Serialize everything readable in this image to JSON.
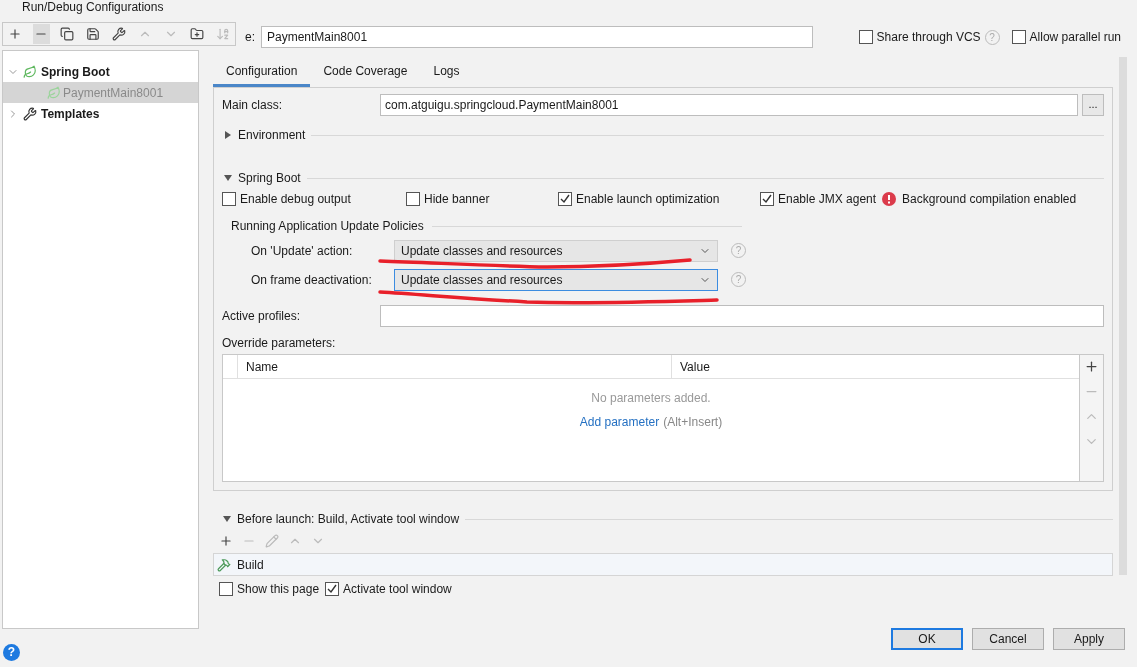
{
  "window": {
    "title": "Run/Debug Configurations"
  },
  "toolbar": [
    {
      "kind": "add",
      "disabled": false,
      "selected": false
    },
    {
      "kind": "remove",
      "disabled": false,
      "selected": true
    },
    {
      "kind": "copy",
      "disabled": false,
      "selected": false
    },
    {
      "kind": "save",
      "disabled": false,
      "selected": false
    },
    {
      "kind": "wrench",
      "disabled": false,
      "selected": false
    },
    {
      "kind": "up",
      "disabled": true,
      "selected": false
    },
    {
      "kind": "down",
      "disabled": true,
      "selected": false
    },
    {
      "kind": "folder",
      "disabled": false,
      "selected": false
    },
    {
      "kind": "sort",
      "disabled": true,
      "selected": false
    }
  ],
  "tree": [
    {
      "label": "Spring Boot",
      "kind": "spring",
      "expanded": true,
      "selected": false,
      "children": [
        {
          "label": "PaymentMain8001",
          "kind": "spring",
          "selected": true
        }
      ]
    },
    {
      "label": "Templates",
      "kind": "wrench",
      "expanded": false,
      "selected": false
    }
  ],
  "help_mark": "?",
  "name": {
    "label": "e:",
    "value": "PaymentMain8001"
  },
  "options": [
    {
      "label": "Share through VCS",
      "checked": false,
      "help": true
    },
    {
      "label": "Allow parallel run",
      "checked": false,
      "help": false
    }
  ],
  "tabs": [
    {
      "label": "Configuration",
      "selected": true
    },
    {
      "label": "Code Coverage",
      "selected": false
    },
    {
      "label": "Logs",
      "selected": false
    }
  ],
  "main_class": {
    "label": "Main class:",
    "value": "com.atguigu.springcloud.PaymentMain8001",
    "browse": "..."
  },
  "environment": {
    "label": "Environment",
    "expanded": false
  },
  "spring_boot": {
    "label": "Spring Boot",
    "expanded": true,
    "checks": [
      {
        "label": "Enable debug output",
        "checked": false
      },
      {
        "label": "Hide banner",
        "checked": false
      },
      {
        "label": "Enable launch optimization",
        "checked": true
      },
      {
        "label": "Enable JMX agent",
        "checked": true
      }
    ],
    "warning": "Background compilation enabled",
    "policies_title": "Running Application Update Policies",
    "policies": [
      {
        "label": "On 'Update' action:",
        "value": "Update classes and resources",
        "focused": false
      },
      {
        "label": "On frame deactivation:",
        "value": "Update classes and resources",
        "focused": true
      }
    ]
  },
  "active_profiles": {
    "label": "Active profiles:"
  },
  "override": {
    "label": "Override parameters:",
    "columns": [
      "Name",
      "Value"
    ],
    "empty": "No parameters added.",
    "link": "Add parameter",
    "shortcut": "(Alt+Insert)",
    "side_buttons": [
      {
        "kind": "add",
        "disabled": false
      },
      {
        "kind": "remove",
        "disabled": true
      },
      {
        "kind": "up",
        "disabled": true
      },
      {
        "kind": "down",
        "disabled": true
      }
    ]
  },
  "before_launch": {
    "label": "Before launch: Build, Activate tool window",
    "expanded": true,
    "tools": [
      {
        "kind": "add",
        "disabled": false
      },
      {
        "kind": "remove",
        "disabled": true
      },
      {
        "kind": "edit",
        "disabled": true
      },
      {
        "kind": "up",
        "disabled": true
      },
      {
        "kind": "down",
        "disabled": true
      }
    ],
    "items": [
      "Build"
    ],
    "checks": [
      {
        "label": "Show this page",
        "checked": false
      },
      {
        "label": "Activate tool window",
        "checked": true
      }
    ]
  },
  "buttons": [
    {
      "label": "OK",
      "default": true
    },
    {
      "label": "Cancel",
      "default": false
    },
    {
      "label": "Apply",
      "default": false
    }
  ]
}
